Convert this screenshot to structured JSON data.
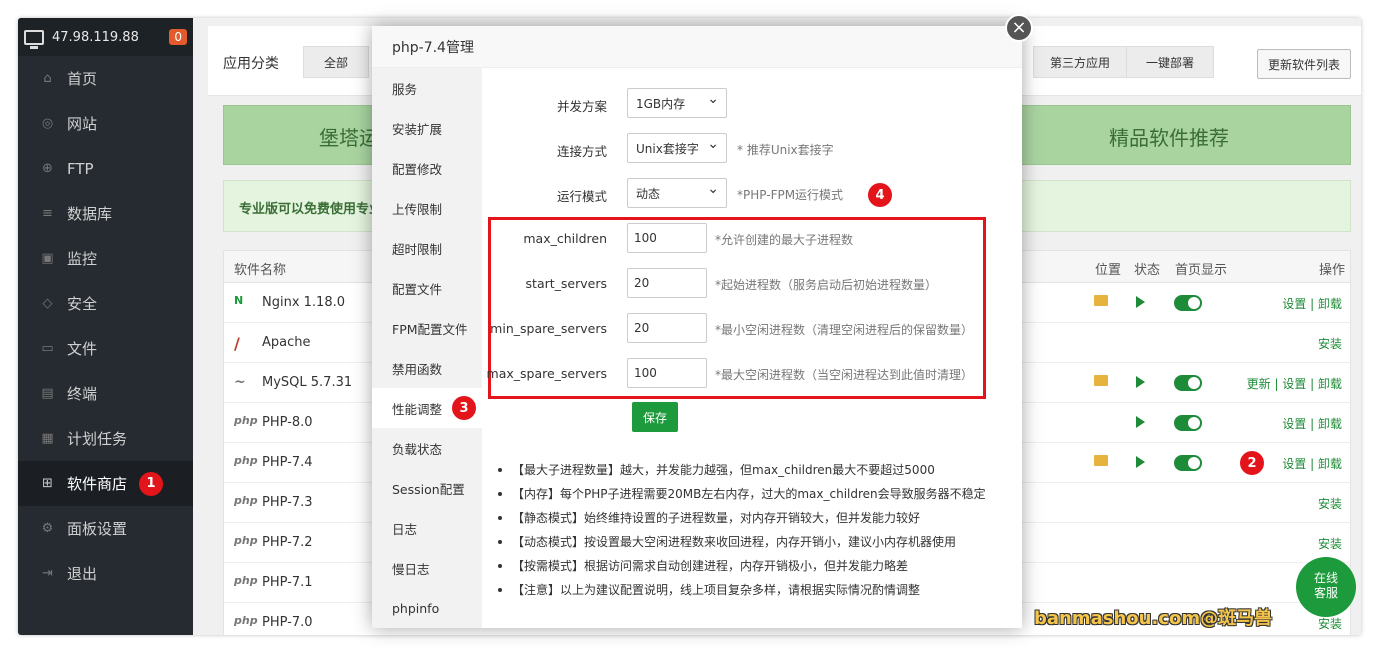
{
  "sidebar": {
    "ip": "47.98.119.88",
    "badge": "0",
    "items": [
      {
        "label": "首页",
        "icon": "home-icon"
      },
      {
        "label": "网站",
        "icon": "globe-icon"
      },
      {
        "label": "FTP",
        "icon": "ftp-icon"
      },
      {
        "label": "数据库",
        "icon": "database-icon"
      },
      {
        "label": "监控",
        "icon": "monitor-icon"
      },
      {
        "label": "安全",
        "icon": "shield-icon"
      },
      {
        "label": "文件",
        "icon": "folder-icon"
      },
      {
        "label": "终端",
        "icon": "terminal-icon"
      },
      {
        "label": "计划任务",
        "icon": "calendar-icon"
      },
      {
        "label": "软件商店",
        "icon": "grid-icon"
      },
      {
        "label": "面板设置",
        "icon": "gear-icon"
      },
      {
        "label": "退出",
        "icon": "logout-icon"
      }
    ],
    "active_marker": "1"
  },
  "main": {
    "category_title": "应用分类",
    "categories": [
      "全部",
      "第三方应用",
      "一键部署"
    ],
    "refresh_label": "更新软件列表",
    "banner_left": "堡塔运",
    "banner_right": "精品软件推荐",
    "pro_notice": "专业版可以免费使用专业",
    "table_headers": {
      "name": "软件名称",
      "location": "位置",
      "status": "状态",
      "homepage": "首页显示",
      "ops": "操作"
    },
    "rows": [
      {
        "logo": "N",
        "name": "Nginx 1.18.0",
        "ops": "设置 | 卸载"
      },
      {
        "logo": "/",
        "name": "Apache",
        "ops": "安装"
      },
      {
        "logo": "~",
        "name": "MySQL 5.7.31",
        "ops": "更新 | 设置 | 卸载"
      },
      {
        "logo": "php",
        "name": "PHP-8.0",
        "ops": "设置 | 卸载"
      },
      {
        "logo": "php",
        "name": "PHP-7.4",
        "ops": "设置 | 卸载"
      },
      {
        "logo": "php",
        "name": "PHP-7.3",
        "ops": "安装"
      },
      {
        "logo": "php",
        "name": "PHP-7.2",
        "ops": "安装"
      },
      {
        "logo": "php",
        "name": "PHP-7.1",
        "ops": "安装"
      },
      {
        "logo": "php",
        "name": "PHP-7.0",
        "ops": "安装"
      }
    ],
    "row_marker": "2"
  },
  "modal": {
    "title": "php-7.4管理",
    "close_glyph": "×",
    "nav": [
      "服务",
      "安装扩展",
      "配置修改",
      "上传限制",
      "超时限制",
      "配置文件",
      "FPM配置文件",
      "禁用函数",
      "性能调整",
      "负载状态",
      "Session配置",
      "日志",
      "慢日志",
      "phpinfo"
    ],
    "nav_marker": "3",
    "form_marker": "4",
    "concurrency": {
      "label": "并发方案",
      "value": "1GB内存"
    },
    "connection": {
      "label": "连接方式",
      "value": "Unix套接字",
      "hint": "* 推荐Unix套接字"
    },
    "run_mode": {
      "label": "运行模式",
      "value": "动态",
      "hint": "*PHP-FPM运行模式"
    },
    "max_children": {
      "label": "max_children",
      "value": "100",
      "hint": "*允许创建的最大子进程数"
    },
    "start_servers": {
      "label": "start_servers",
      "value": "20",
      "hint": "*起始进程数（服务启动后初始进程数量）"
    },
    "min_spare_servers": {
      "label": "min_spare_servers",
      "value": "20",
      "hint": "*最小空闲进程数（清理空闲进程后的保留数量）"
    },
    "max_spare_servers": {
      "label": "max_spare_servers",
      "value": "100",
      "hint": "*最大空闲进程数（当空闲进程达到此值时清理）"
    },
    "save_label": "保存",
    "tips": [
      "【最大子进程数量】越大，并发能力越强，但max_children最大不要超过5000",
      "【内存】每个PHP子进程需要20MB左右内存，过大的max_children会导致服务器不稳定",
      "【静态模式】始终维持设置的子进程数量，对内存开销较大，但并发能力较好",
      "【动态模式】按设置最大空闲进程数来收回进程，内存开销小，建议小内存机器使用",
      "【按需模式】根据访问需求自动创建进程，内存开销极小，但并发能力略差",
      "【注意】以上为建议配置说明，线上项目复杂多样，请根据实际情况酌情调整"
    ]
  },
  "chat": {
    "line1": "在线",
    "line2": "客服"
  },
  "watermark": "banmashou.com@斑马兽"
}
